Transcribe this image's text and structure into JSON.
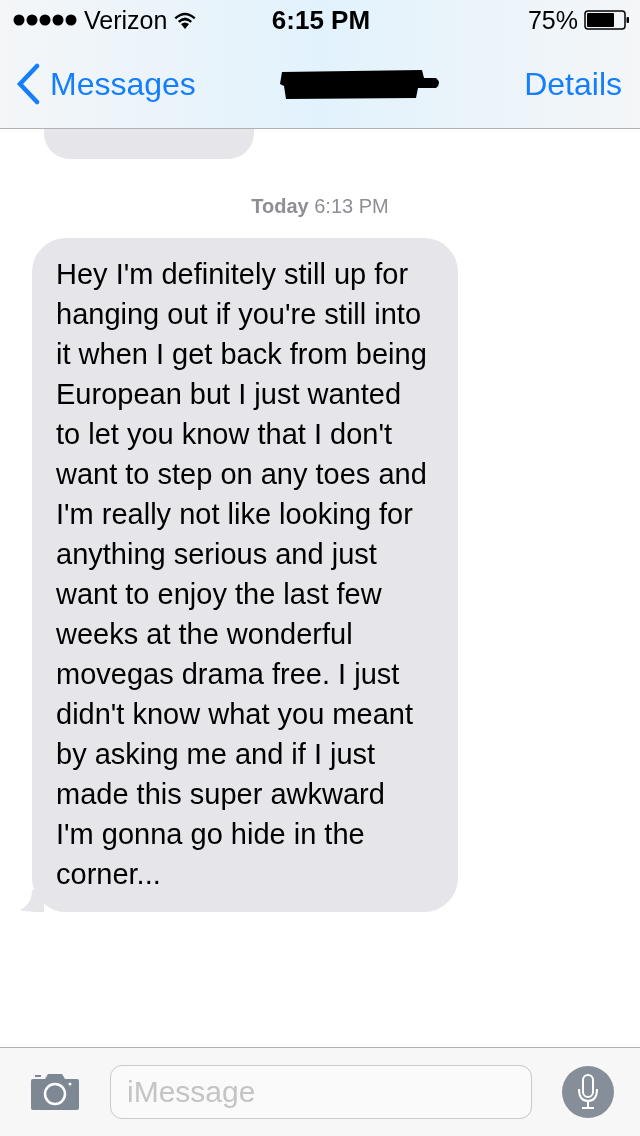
{
  "status_bar": {
    "carrier": "Verizon",
    "time": "6:15 PM",
    "battery": "75%"
  },
  "nav": {
    "back": "Messages",
    "action": "Details"
  },
  "timestamp": "**Today** 6:13 PM",
  "messages": [
    {
      "kind": "partial"
    },
    {
      "kind": "received",
      "text": "Hey I'm definitely still up for hanging out if you're still into it when I get back from being European but I just wanted to let you know that I don't want to step on any toes and I'm really not like looking for anything serious and just want to enjoy the last few weeks at the wonderful movegas drama free. I just didn't know what you meant by asking me and if I just made this super awkward I'm gonna go hide in the corner..."
    }
  ],
  "composer": {
    "placeholder": "iMessage"
  }
}
